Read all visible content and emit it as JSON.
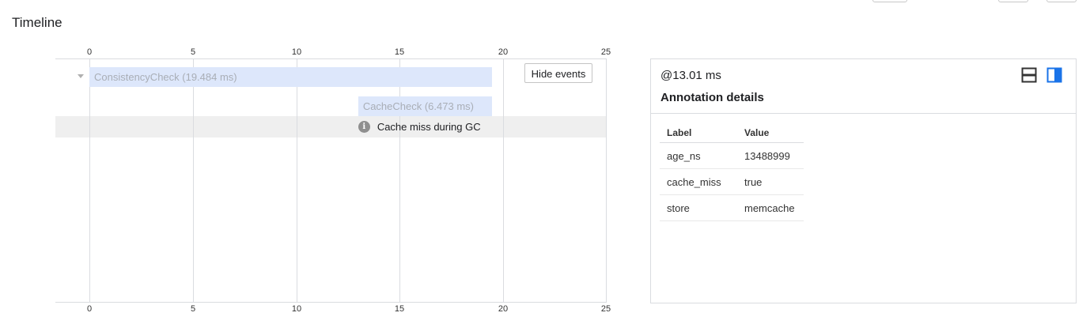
{
  "page": {
    "title": "Timeline"
  },
  "timeline": {
    "axis_ticks": [
      "0",
      "5",
      "10",
      "15",
      "20",
      "25"
    ],
    "axis_max": 25,
    "spans": [
      {
        "label": "ConsistencyCheck (19.484 ms)",
        "start_ms": 0,
        "duration_ms": 19.484
      },
      {
        "label": "CacheCheck (6.473 ms)",
        "start_ms": 13.01,
        "duration_ms": 6.473
      }
    ],
    "event": {
      "label": "Cache miss during GC",
      "icon": "info-icon",
      "time_ms": 13.01
    },
    "hide_events_label": "Hide events"
  },
  "details": {
    "time": "@13.01 ms",
    "title": "Annotation details",
    "columns": [
      "Label",
      "Value"
    ],
    "rows": [
      [
        "age_ns",
        "13488999"
      ],
      [
        "cache_miss",
        "true"
      ],
      [
        "store",
        "memcache"
      ]
    ],
    "layout_icons": [
      "horizontal-split-icon",
      "vertical-split-icon"
    ],
    "accent_color": "#1a73e8"
  }
}
